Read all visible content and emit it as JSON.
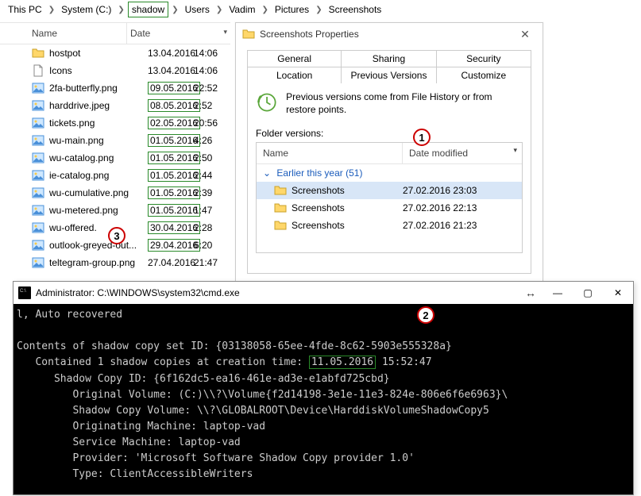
{
  "breadcrumb": {
    "items": [
      "This PC",
      "System (C:)",
      "shadow",
      "Users",
      "Vadim",
      "Pictures",
      "Screenshots"
    ],
    "boxed_index": 2
  },
  "filelist": {
    "headers": {
      "name": "Name",
      "date": "Date"
    },
    "rows": [
      {
        "icon": "folder",
        "name": "hostpot",
        "date": "13.04.2016",
        "time": "14:06",
        "box_date": false
      },
      {
        "icon": "file",
        "name": "Icons",
        "date": "13.04.2016",
        "time": "14:06",
        "box_date": false
      },
      {
        "icon": "image",
        "name": "2fa-butterfly.png",
        "date": "09.05.2016",
        "time": "22:52",
        "box_date": true
      },
      {
        "icon": "image",
        "name": "harddrive.jpeg",
        "date": "08.05.2016",
        "time": "2:52",
        "box_date": true
      },
      {
        "icon": "image",
        "name": "tickets.png",
        "date": "02.05.2016",
        "time": "20:56",
        "box_date": true
      },
      {
        "icon": "image",
        "name": "wu-main.png",
        "date": "01.05.2016",
        "time": "4:26",
        "box_date": true
      },
      {
        "icon": "image",
        "name": "wu-catalog.png",
        "date": "01.05.2016",
        "time": "2:50",
        "box_date": true
      },
      {
        "icon": "image",
        "name": "ie-catalog.png",
        "date": "01.05.2016",
        "time": "2:44",
        "box_date": true
      },
      {
        "icon": "image",
        "name": "wu-cumulative.png",
        "date": "01.05.2016",
        "time": "2:39",
        "box_date": true
      },
      {
        "icon": "image",
        "name": "wu-metered.png",
        "date": "01.05.2016",
        "time": "1:47",
        "box_date": true
      },
      {
        "icon": "image",
        "name": "wu-offered.",
        "date": "30.04.2016",
        "time": "2:28",
        "box_date": true
      },
      {
        "icon": "image",
        "name": "outlook-greyed-out...",
        "date": "29.04.2016",
        "time": "6:20",
        "box_date": true
      },
      {
        "icon": "image",
        "name": "teltegram-group.png",
        "date": "27.04.2016",
        "time": "21:47",
        "box_date": false
      }
    ]
  },
  "props": {
    "title": "Screenshots Properties",
    "tabs_row1": [
      "General",
      "Sharing",
      "Security"
    ],
    "tabs_row2": [
      "Location",
      "Previous Versions",
      "Customize"
    ],
    "active_tab": "Previous Versions",
    "desc": "Previous versions come from File History or from restore points.",
    "folder_versions_label": "Folder versions:",
    "version_headers": {
      "name": "Name",
      "date": "Date modified"
    },
    "group_label": "Earlier this year (51)",
    "versions": [
      {
        "name": "Screenshots",
        "date": "27.02.2016 23:03",
        "selected": true
      },
      {
        "name": "Screenshots",
        "date": "27.02.2016 22:13",
        "selected": false
      },
      {
        "name": "Screenshots",
        "date": "27.02.2016 21:23",
        "selected": false
      }
    ]
  },
  "cmd": {
    "title": "Administrator: C:\\WINDOWS\\system32\\cmd.exe",
    "lines_pre": "l, Auto recovered\n\nContents of shadow copy set ID: {03138058-65ee-4fde-8c62-5903e555328a}\n   Contained 1 shadow copies at creation time: ",
    "highlight_date": "11.05.2016",
    "lines_post": " 15:52:47\n      Shadow Copy ID: {6f162dc5-ea16-461e-ad3e-e1abfd725cbd}\n         Original Volume: (C:)\\\\?\\Volume{f2d14198-3e1e-11e3-824e-806e6f6e6963}\\\n         Shadow Copy Volume: \\\\?\\GLOBALROOT\\Device\\HarddiskVolumeShadowCopy5\n         Originating Machine: laptop-vad\n         Service Machine: laptop-vad\n         Provider: 'Microsoft Software Shadow Copy provider 1.0'\n         Type: ClientAccessibleWriters"
  },
  "callouts": {
    "c1": "1",
    "c2": "2",
    "c3": "3"
  }
}
